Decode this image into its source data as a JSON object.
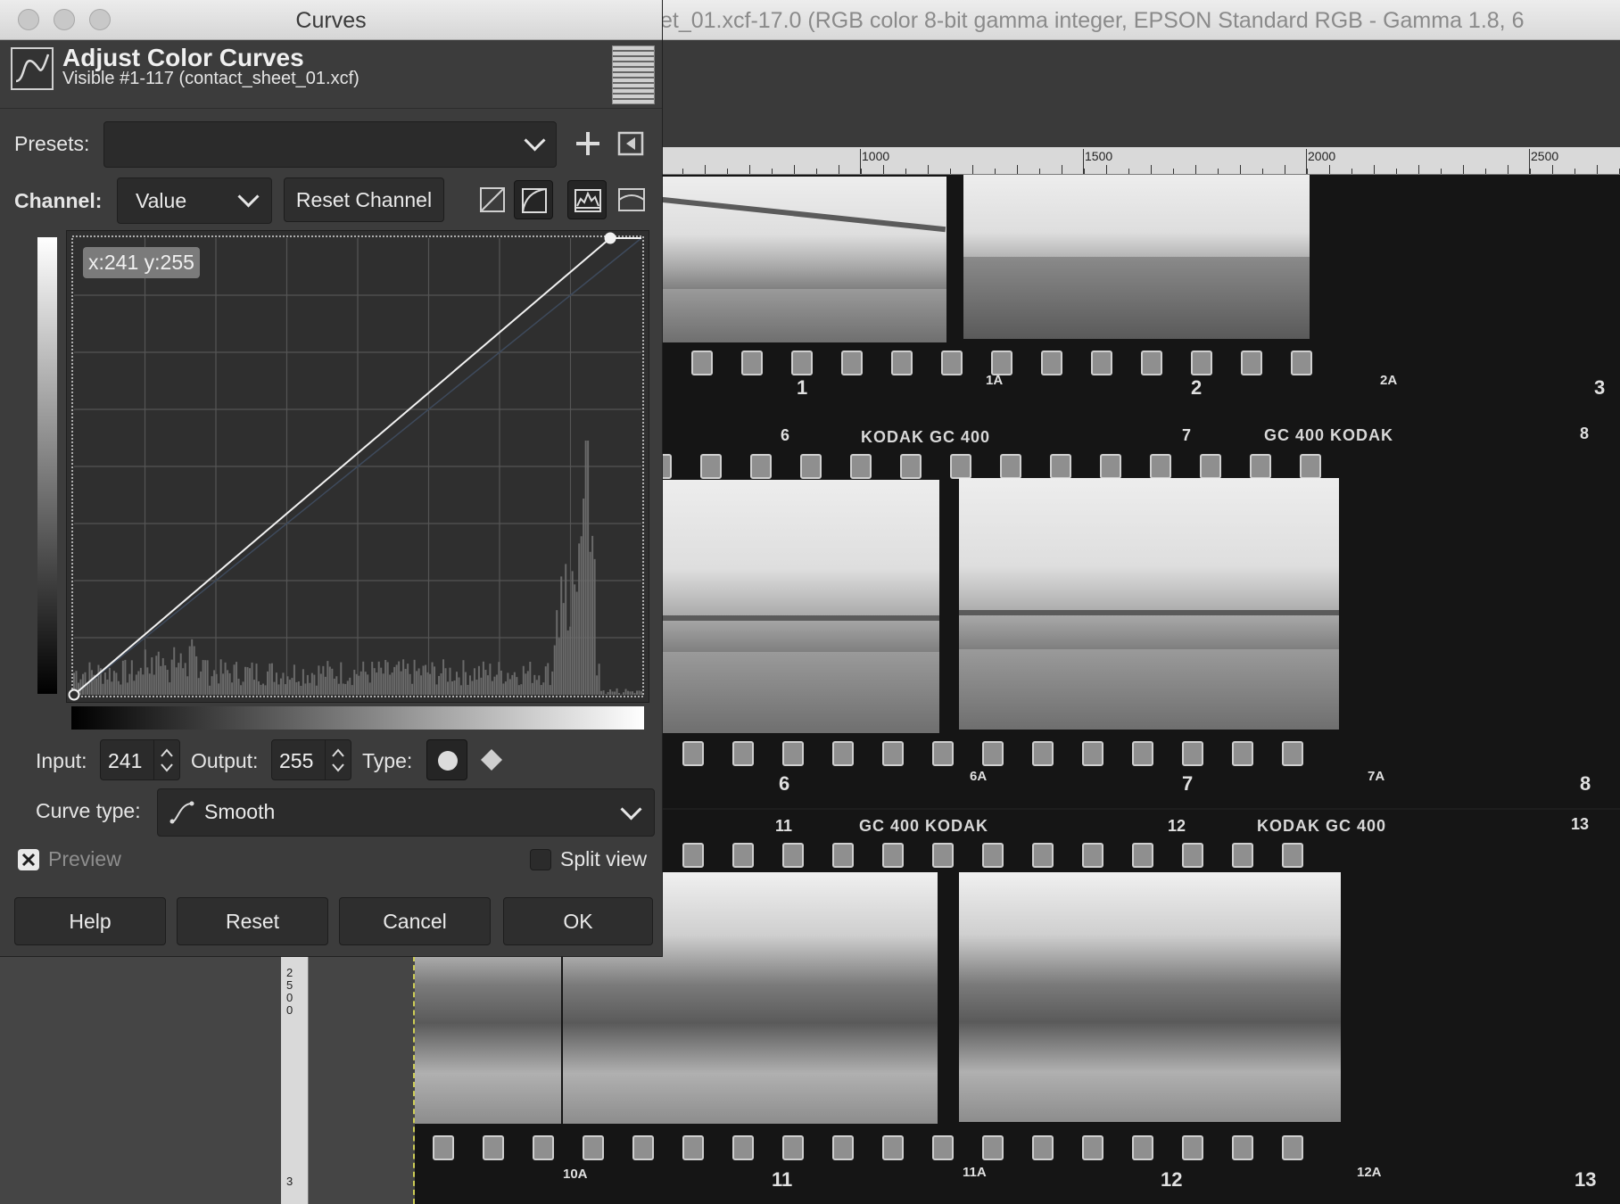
{
  "background_window": {
    "title": "et_01.xcf-17.0 (RGB color 8-bit gamma integer, EPSON  Standard RGB - Gamma 1.8, 6",
    "ruler_top_labels": [
      "1000",
      "1500",
      "2000",
      "2500"
    ],
    "ruler_left_label": "2500",
    "ruler_left_label2": "3",
    "contact_sheet": {
      "edge_labels": [
        "KODAK  GC 400",
        "GC 400  KODAK",
        "GC 400  KODAK",
        "KODAK  GC 400"
      ],
      "frame_numbers": [
        "1",
        "1A",
        "2",
        "2A",
        "3",
        "6",
        "7",
        "8",
        "6",
        "6A",
        "7",
        "7A",
        "8",
        "11",
        "12",
        "13",
        "10A",
        "11",
        "11A",
        "12",
        "12A",
        "13"
      ]
    }
  },
  "dialog": {
    "window_title": "Curves",
    "header_title": "Adjust Color Curves",
    "header_subtitle": "Visible #1-117 (contact_sheet_01.xcf)",
    "presets_label": "Presets:",
    "presets_value": "",
    "channel_label": "Channel:",
    "channel_value": "Value",
    "reset_channel_label": "Reset Channel",
    "coord_readout": "x:241 y:255",
    "input_label": "Input:",
    "input_value": "241",
    "output_label": "Output:",
    "output_value": "255",
    "type_label": "Type:",
    "curve_type_label": "Curve type:",
    "curve_type_value": "Smooth",
    "preview_label": "Preview",
    "preview_checked": true,
    "split_view_label": "Split view",
    "split_view_checked": false,
    "buttons": {
      "help": "Help",
      "reset": "Reset",
      "cancel": "Cancel",
      "ok": "OK"
    },
    "curve_points": [
      [
        0,
        0
      ],
      [
        241,
        255
      ]
    ],
    "icons": [
      "curves-icon",
      "add-preset-icon",
      "preset-menu-icon",
      "linear-histogram-icon",
      "log-histogram-icon",
      "free-mode-icon",
      "smooth-mode-icon",
      "smooth-point-icon",
      "corner-point-icon",
      "chevron-down-icon"
    ]
  }
}
